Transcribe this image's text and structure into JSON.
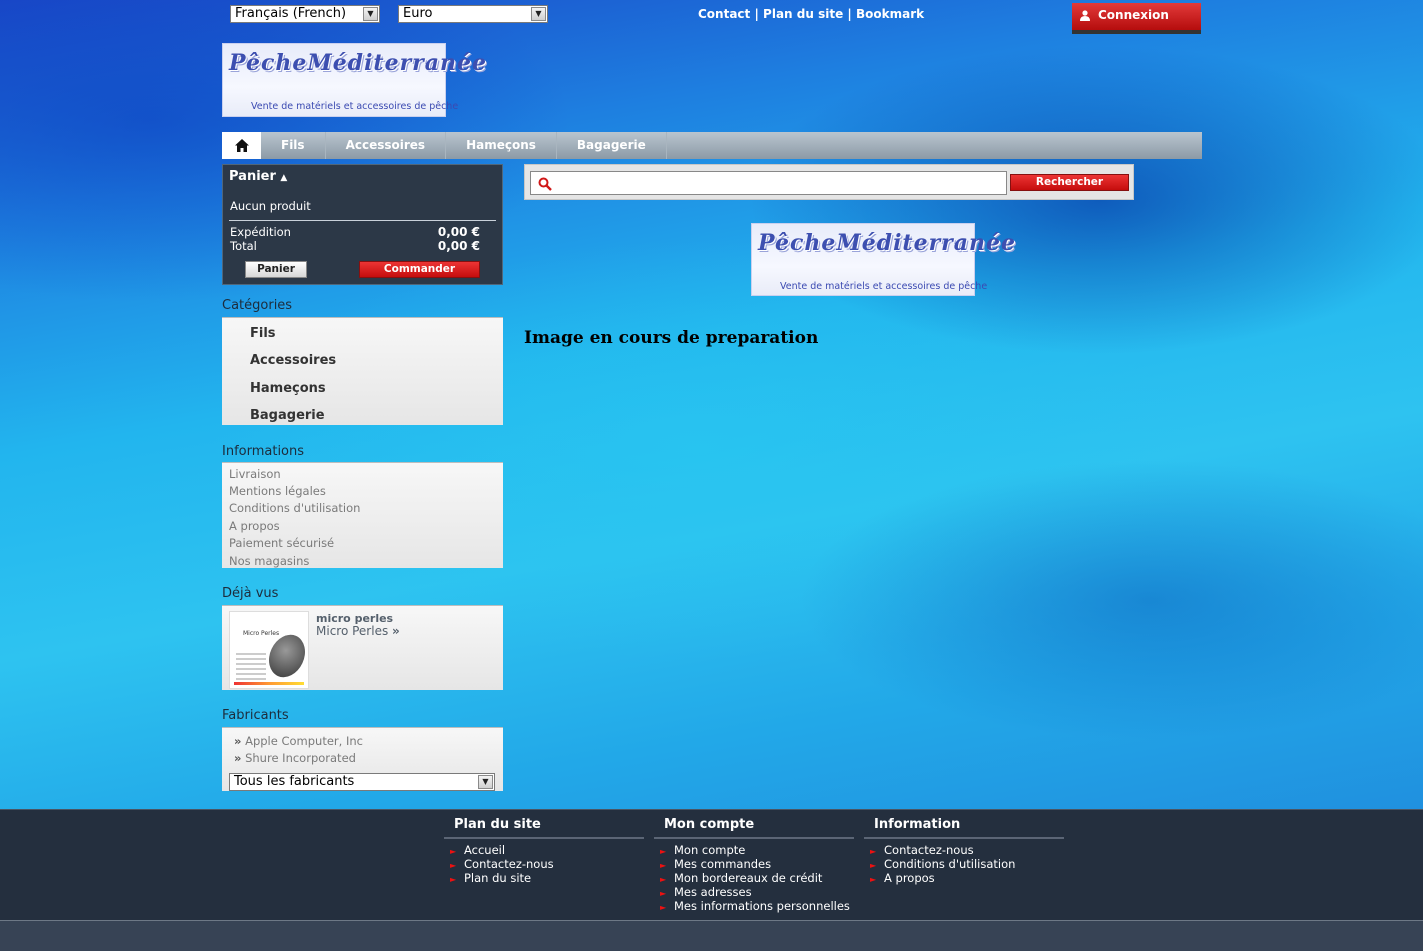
{
  "header": {
    "language_select": "Français (French)",
    "currency_select": "Euro",
    "links": [
      "Contact",
      "Plan du site",
      "Bookmark"
    ],
    "link_separator": "|",
    "login_label": "Connexion"
  },
  "logo": {
    "brand_text": "PêcheMéditerranée",
    "tagline": "Vente de matériels et accessoires de pêche"
  },
  "menu": {
    "home_icon": "home-icon",
    "items": [
      "Fils",
      "Accessoires",
      "Hameçons",
      "Bagagerie"
    ]
  },
  "cart": {
    "title": "Panier",
    "empty_text": "Aucun produit",
    "shipping_label": "Expédition",
    "shipping_value": "0,00 €",
    "total_label": "Total",
    "total_value": "0,00 €",
    "cart_button": "Panier",
    "checkout_button": "Commander"
  },
  "categories": {
    "title": "Catégories",
    "items": [
      "Fils",
      "Accessoires",
      "Hameçons",
      "Bagagerie"
    ]
  },
  "informations": {
    "title": "Informations",
    "items": [
      "Livraison",
      "Mentions légales",
      "Conditions d'utilisation",
      "A propos",
      "Paiement sécurisé",
      "Nos magasins"
    ]
  },
  "viewed": {
    "title": "Déjà vus",
    "product_name": "micro perles",
    "product_desc": "Micro Perles",
    "thumb_title": "Micro Perles"
  },
  "manufacturers": {
    "title": "Fabricants",
    "items": [
      "Apple Computer, Inc",
      "Shure Incorporated"
    ],
    "select": "Tous les fabricants"
  },
  "search": {
    "placeholder": "",
    "button": "Rechercher"
  },
  "main": {
    "headline": "Image en cours de preparation"
  },
  "footer": {
    "columns": [
      {
        "title": "Plan du site",
        "items": [
          "Accueil",
          "Contactez-nous",
          "Plan du site"
        ]
      },
      {
        "title": "Mon compte",
        "items": [
          "Mon compte",
          "Mes commandes",
          "Mon bordereaux de crédit",
          "Mes adresses",
          "Mes informations personnelles"
        ]
      },
      {
        "title": "Information",
        "items": [
          "Contactez-nous",
          "Conditions d'utilisation",
          "A propos"
        ]
      }
    ]
  },
  "colors": {
    "accent_red": "#d01818",
    "dark_panel": "#2c3847",
    "footer_bg": "#242f3e"
  }
}
